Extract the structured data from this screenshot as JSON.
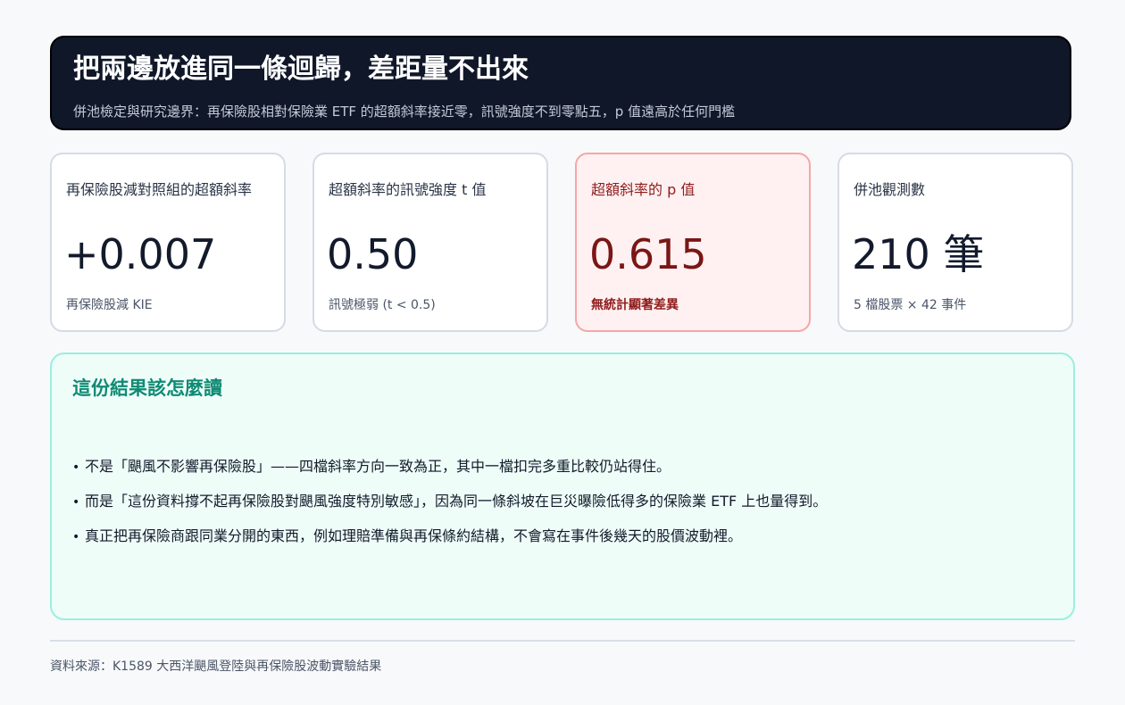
{
  "header": {
    "title": "把兩邊放進同一條迴歸，差距量不出來",
    "subtitle": "併池檢定與研究邊界：再保險股相對保險業 ETF 的超額斜率接近零，訊號強度不到零點五，p 值遠高於任何門檻"
  },
  "cards": [
    {
      "label": "再保險股減對照組的超額斜率",
      "value": "+0.007",
      "note": "再保險股減 KIE"
    },
    {
      "label": "超額斜率的訊號強度 t 值",
      "value": "0.50",
      "note": "訊號極弱 (t < 0.5)"
    },
    {
      "label": "超額斜率的 p 值",
      "value": "0.615",
      "note": "無統計顯著差異"
    },
    {
      "label": "併池觀測數",
      "value": "210 筆",
      "note": "5 檔股票 × 42 事件"
    }
  ],
  "panel": {
    "title": "這份結果該怎麼讀",
    "bullet_glyph": "•",
    "items": [
      "不是「颶風不影響再保險股」——四檔斜率方向一致為正，其中一檔扣完多重比較仍站得住。",
      "而是「這份資料撐不起再保險股對颶風強度特別敏感」，因為同一條斜坡在巨災曝險低得多的保險業 ETF 上也量得到。",
      "真正把再保險商跟同業分開的東西，例如理賠準備與再保條約結構，不會寫在事件後幾天的股價波動裡。"
    ]
  },
  "footer": {
    "source": "資料來源：K1589 大西洋颶風登陸與再保險股波動實驗結果"
  },
  "colors": {
    "header_bg": "#0f1729",
    "highlight_card_bg": "#fff1f1",
    "highlight_card_border": "#f4a7a7",
    "highlight_text": "#7a1616",
    "panel_bg": "#effdf9",
    "panel_border": "#99f0dc",
    "panel_title": "#0f8a73"
  }
}
